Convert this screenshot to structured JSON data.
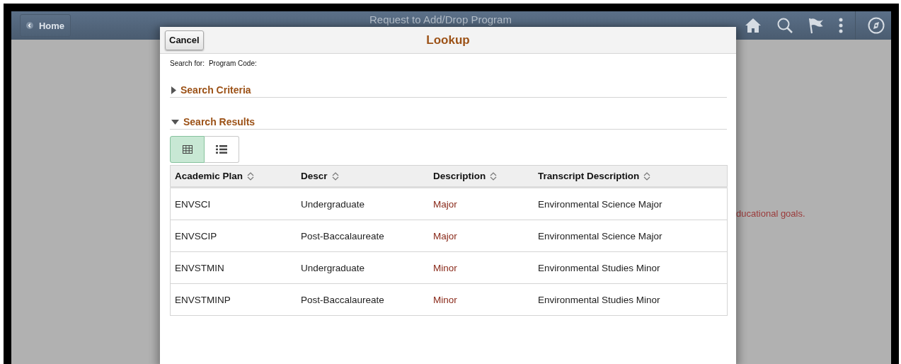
{
  "header": {
    "back_button": "Home",
    "title": "Request to Add/Drop Program"
  },
  "background_text": "ducational goals.",
  "lookup": {
    "cancel_button": "Cancel",
    "title": "Lookup",
    "search_for_label": "Search for:",
    "search_for_value": "Program Code:",
    "sections": [
      {
        "title": "Search Criteria",
        "expanded": false
      },
      {
        "title": "Search Results",
        "expanded": true
      }
    ],
    "view_toggle": [
      {
        "kind": "grid",
        "selected": true
      },
      {
        "kind": "list",
        "selected": false
      }
    ],
    "table": {
      "columns": [
        "Academic Plan",
        "Descr",
        "Description",
        "Transcript Description"
      ],
      "rows": [
        [
          "ENVSCI",
          "Undergraduate",
          "Major",
          "Environmental Science Major"
        ],
        [
          "ENVSCIP",
          "Post-Baccalaureate",
          "Major",
          "Environmental Science Major"
        ],
        [
          "ENVSTMIN",
          "Undergraduate",
          "Minor",
          "Environmental Studies Minor"
        ],
        [
          "ENVSTMINP",
          "Post-Baccalaureate",
          "Minor",
          "Environmental Studies Minor"
        ]
      ]
    }
  }
}
